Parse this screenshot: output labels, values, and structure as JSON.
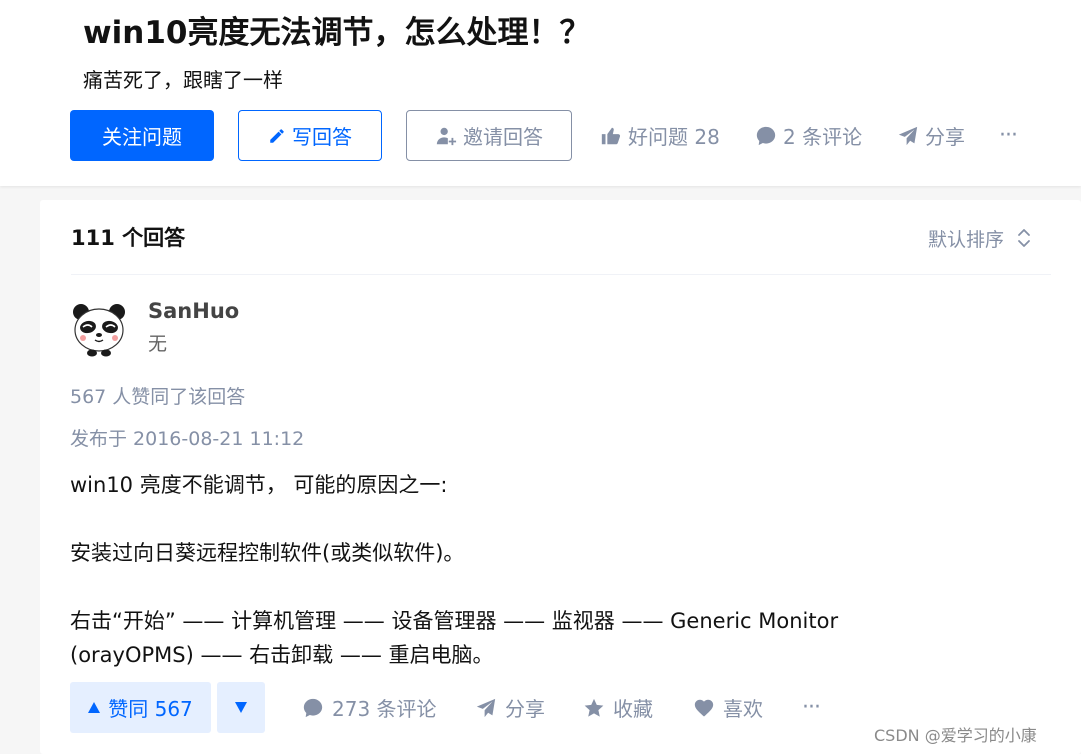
{
  "question": {
    "title": "win10亮度无法调节，怎么处理！？",
    "detail": "痛苦死了，跟瞎了一样",
    "follow_label": "关注问题",
    "write_label": "写回答",
    "invite_label": "邀请回答",
    "good_question_label": "好问题 28",
    "comments_label": "2 条评论",
    "share_label": "分享",
    "more_label": "···"
  },
  "answers": {
    "count_label": "111 个回答",
    "sort_label": "默认排序"
  },
  "answer": {
    "author_name": "SanHuo",
    "author_bio": "无",
    "votes_text": "567 人赞同了该回答",
    "published": "发布于 2016-08-21 11:12",
    "paragraphs": [
      "win10 亮度不能调节， 可能的原因之一:",
      "安装过向日葵远程控制软件(或类似软件)。",
      "右击“开始” —— 计算机管理 —— 设备管理器 —— 监视器 —— Generic Monitor",
      "(orayOPMS) —— 右击卸载 —— 重启电脑。"
    ],
    "actions": {
      "upvote_label": "赞同 567",
      "comments_label": "273 条评论",
      "share_label": "分享",
      "favorite_label": "收藏",
      "like_label": "喜欢",
      "more_label": "···"
    }
  },
  "watermark": "CSDN @爱学习的小康",
  "colors": {
    "accent": "#0066ff",
    "muted": "#8590a6",
    "vote_bg": "#e5efff",
    "page_bg": "#f6f6f6"
  },
  "icons": {
    "write": "pencil-icon",
    "invite": "add-user-icon",
    "good_question": "thumbs-up-icon",
    "comment": "comment-bubble-icon",
    "share": "paper-plane-icon",
    "sort": "sort-updown-icon",
    "upvote": "triangle-up-icon",
    "downvote": "triangle-down-icon",
    "favorite": "star-icon",
    "like": "heart-icon"
  }
}
